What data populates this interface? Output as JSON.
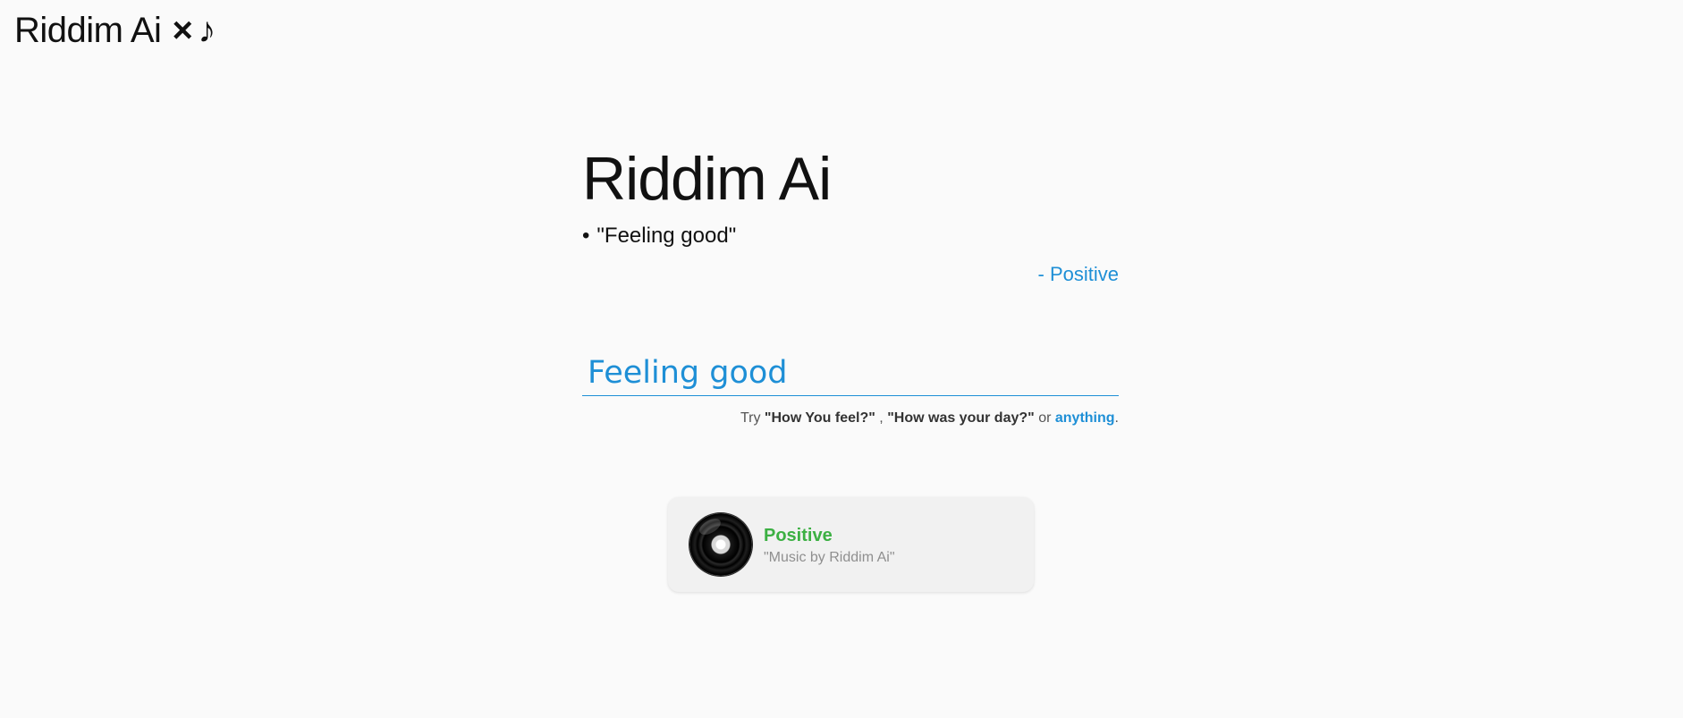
{
  "brand": {
    "name": "Riddim Ai",
    "separator": "×",
    "note": "♪"
  },
  "main": {
    "title": "Riddim Ai",
    "bullet": "•",
    "quote": "\"Feeling good\"",
    "sentiment": "- Positive"
  },
  "input": {
    "value": "Feeling good",
    "placeholder": ""
  },
  "hint": {
    "prefix": "Try",
    "example1": "\"How You feel?\"",
    "comma": ",",
    "example2": "\"How was your day?\"",
    "or": "or",
    "link": "anything",
    "period": "."
  },
  "player": {
    "icon": "vinyl-record-icon",
    "title": "Positive",
    "artist": "\"Music by Riddim Ai\""
  },
  "colors": {
    "accent": "#1e8fd6",
    "positive": "#3cb043",
    "background": "#fafafa",
    "card": "#f1f1f1"
  }
}
